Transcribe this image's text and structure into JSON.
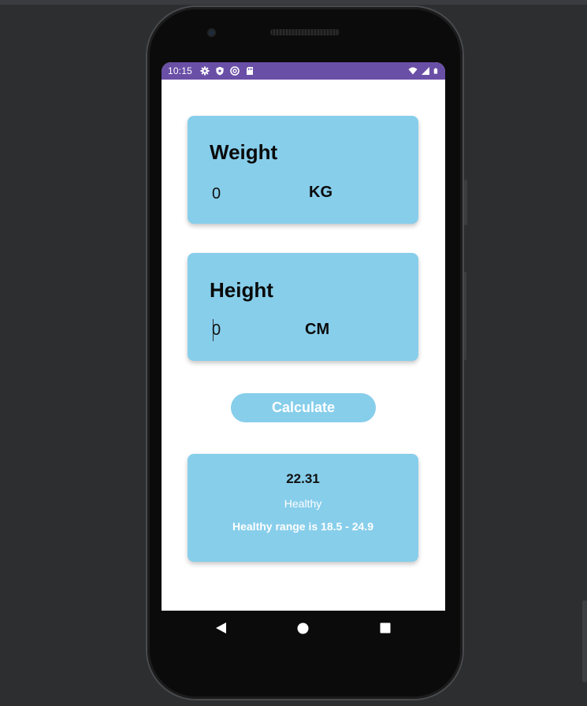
{
  "status_bar": {
    "time": "10:15",
    "left_icons": [
      "gear-icon",
      "shield-icon",
      "sync-icon",
      "sd-card-icon"
    ],
    "right_icons": [
      "wifi-icon",
      "signal-icon",
      "battery-icon"
    ],
    "color": "#6a4fa6"
  },
  "weight_card": {
    "title": "Weight",
    "value": "0",
    "unit": "KG"
  },
  "height_card": {
    "title": "Height",
    "value": "0",
    "unit": "CM"
  },
  "calculate_button": {
    "label": "Calculate"
  },
  "result_card": {
    "bmi_value": "22.31",
    "status": "Healthy",
    "range_text": "Healthy range is 18.5 - 24.9"
  },
  "navigation": {
    "buttons": [
      "back-icon",
      "home-icon",
      "recents-icon"
    ]
  },
  "colors": {
    "card": "#87ceeb",
    "status_bar": "#6a4fa6",
    "screen_bg": "#ffffff"
  }
}
